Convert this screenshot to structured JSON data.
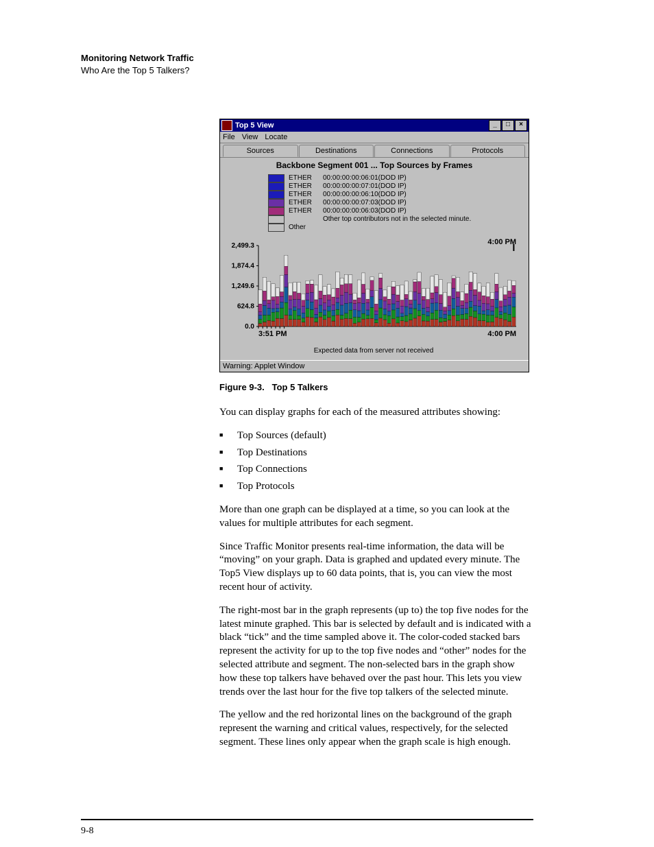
{
  "header": {
    "title": "Monitoring Network Traffic",
    "subtitle": "Who Are the Top 5 Talkers?"
  },
  "figure": {
    "window_title": "Top 5 View",
    "menus": {
      "file": "File",
      "view": "View",
      "locate": "Locate"
    },
    "tabs": {
      "sources": "Sources",
      "destinations": "Destinations",
      "connections": "Connections",
      "protocols": "Protocols"
    },
    "chart_title": "Backbone Segment 001 ... Top Sources by Frames",
    "legend": [
      {
        "color": "#1b1bb8",
        "label": "ETHER",
        "detail": "00:00:00:00:06:01(DOD IP)"
      },
      {
        "color": "#1b1bb8",
        "label": "ETHER",
        "detail": "00:00:00:00:07:01(DOD IP)"
      },
      {
        "color": "#1b1bb8",
        "label": "ETHER",
        "detail": "00:00:00:00:06:10(DOD IP)"
      },
      {
        "color": "#6a2fa5",
        "label": "ETHER",
        "detail": "00:00:00:00:07:03(DOD IP)"
      },
      {
        "color": "#a12c7a",
        "label": "ETHER",
        "detail": "00:00:00:00:06:03(DOD IP)"
      },
      {
        "color": "#c0c0c0",
        "label": "",
        "detail": "Other top contributors not in the selected minute."
      },
      {
        "color": "#c0c0c0",
        "label": "Other",
        "detail": ""
      }
    ],
    "y_ticks": [
      "2,499.3",
      "1,874.4",
      "1,249.6",
      "624.8",
      "0.0"
    ],
    "x_left": "3:51 PM",
    "x_right": "4:00 PM",
    "marker_time": "4:00 PM",
    "server_msg": "Expected data from server not received",
    "applet_warning": "Warning: Applet Window"
  },
  "caption": {
    "label": "Figure 9-3.",
    "text": "Top 5 Talkers"
  },
  "body": {
    "intro": "You can display graphs for each of the measured attributes showing:",
    "bullets": [
      "Top Sources (default)",
      "Top Destinations",
      "Top Connections",
      "Top Protocols"
    ],
    "p1": "More than one graph can be displayed at a time, so you can look at the values for multiple attributes for each segment.",
    "p2": "Since Traffic Monitor presents real-time information, the data will be “moving” on your graph. Data is graphed and updated every minute. The Top5 View displays up to 60 data points, that is, you can view the most recent hour of activity.",
    "p3": "The right-most bar in the graph represents (up to) the top five nodes for the latest minute graphed. This bar is selected by default and is indicated with a black “tick” and the time sampled above it. The color-coded stacked bars represent the activity for up to the top five nodes and “other” nodes for the selected attribute and segment. The non-selected bars in the graph show how these top talkers have behaved over the past hour. This lets you view trends over the last hour for the five top talkers of the selected minute.",
    "p4": "The yellow and the red horizontal lines on the background of the graph represent the warning and critical values, respectively, for the selected segment. These lines only appear when the graph scale is high enough."
  },
  "page_number": "9-8",
  "chart_data": {
    "type": "bar",
    "title": "Backbone Segment 001 ... Top Sources by Frames",
    "xlabel": "",
    "ylabel": "",
    "x_range": [
      "3:51 PM",
      "4:00 PM"
    ],
    "ylim": [
      0.0,
      2499.3
    ],
    "y_ticks": [
      0.0,
      624.8,
      1249.6,
      1874.4,
      2499.3
    ],
    "series_names": [
      "ETHER 00:00:00:00:06:01(DOD IP)",
      "ETHER 00:00:00:00:07:01(DOD IP)",
      "ETHER 00:00:00:00:06:10(DOD IP)",
      "ETHER 00:00:00:00:07:03(DOD IP)",
      "ETHER 00:00:00:00:06:03(DOD IP)",
      "Other top contributors not in the selected minute.",
      "Other"
    ],
    "series_colors": [
      "#b03524",
      "#129022",
      "#125c9e",
      "#6a2fa5",
      "#a12c7a",
      "#d0d0d0",
      "#e6e6e6"
    ],
    "stacked": true,
    "selected_index": 59,
    "note": "Each minute is a stacked bar of frames contributed by up to 5 top talkers plus Other. Totals roughly between 900 and 1800 with one spike near 2200 around minute 6."
  }
}
